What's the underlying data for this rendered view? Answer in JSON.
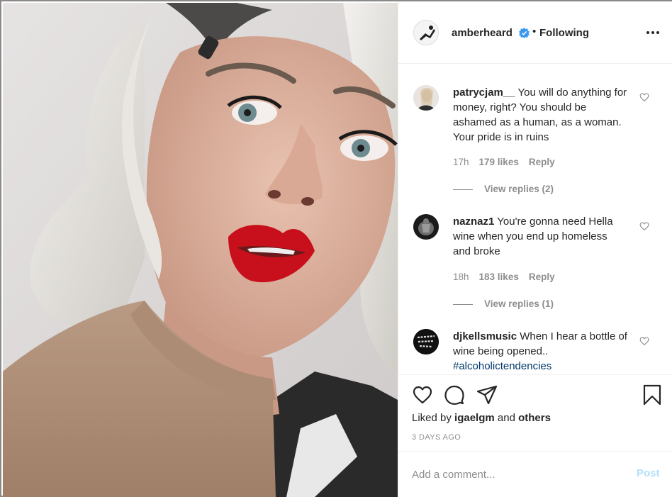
{
  "header": {
    "username": "amberheard",
    "verified_icon": "verified-badge-icon",
    "separator": "•",
    "follow_status": "Following",
    "more_icon": "more-options-icon"
  },
  "comments": [
    {
      "username": "patrycjam__",
      "text": "You will do anything for money, right? You should be ashamed as a human, as a woman. Your pride is in ruins",
      "time": "17h",
      "likes": "179 likes",
      "reply": "Reply",
      "view_replies": "View replies (2)"
    },
    {
      "username": "naznaz1",
      "text": "You're gonna need Hella wine when you end up homeless and broke",
      "time": "18h",
      "likes": "183 likes",
      "reply": "Reply",
      "view_replies": "View replies (1)"
    },
    {
      "username": "djkellsmusic",
      "text": "When I hear a bottle of wine being opened..",
      "tag": "#alcoholictendencies",
      "avatar_text": "DREAM. HUSTLE. WIN."
    }
  ],
  "actions": {
    "like_icon": "heart-icon",
    "comment_icon": "comment-bubble-icon",
    "share_icon": "paper-plane-icon",
    "save_icon": "bookmark-icon"
  },
  "liked_by": {
    "prefix": "Liked by",
    "user": "igaelgm",
    "middle": "and",
    "others": "others"
  },
  "date": "3 DAYS AGO",
  "add_comment": {
    "placeholder": "Add a comment...",
    "post_label": "Post"
  },
  "colors": {
    "verified_blue": "#3897f0",
    "link_blue": "#00376b",
    "post_disabled": "#b2dffc",
    "lips": "#c8101c"
  }
}
